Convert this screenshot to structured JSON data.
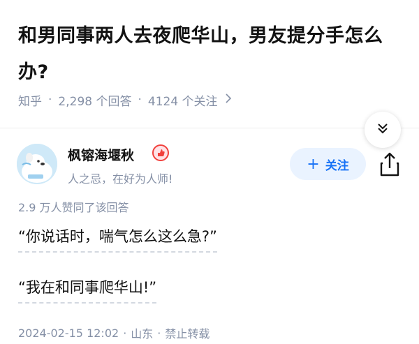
{
  "question": {
    "title": "和男同事两人去夜爬华山，男友提分手怎么办?",
    "source": "知乎",
    "answers": "2,298 个回答",
    "followers": "4124 个关注"
  },
  "author": {
    "name": "枫镕海堰秋",
    "bio": "人之忌，在好为人师!",
    "follow_label": "关注"
  },
  "answer": {
    "votes": "2.9 万人赞同了该回答",
    "lines": [
      "“你说话时，喘气怎么这么急?”",
      "“我在和同事爬华山!”"
    ],
    "date": "2024-02-15 12:02",
    "location": "山东",
    "copyright": "禁止转载"
  },
  "icons": {
    "collapse": "double-chevron-down-icon",
    "share": "share-icon",
    "badge": "creator-badge-icon",
    "meta_more": "chevron-right-icon"
  },
  "colors": {
    "accent": "#1772f6",
    "follow_bg": "#eaf3ff",
    "muted": "#8590a6",
    "badge": "#f1403c"
  }
}
